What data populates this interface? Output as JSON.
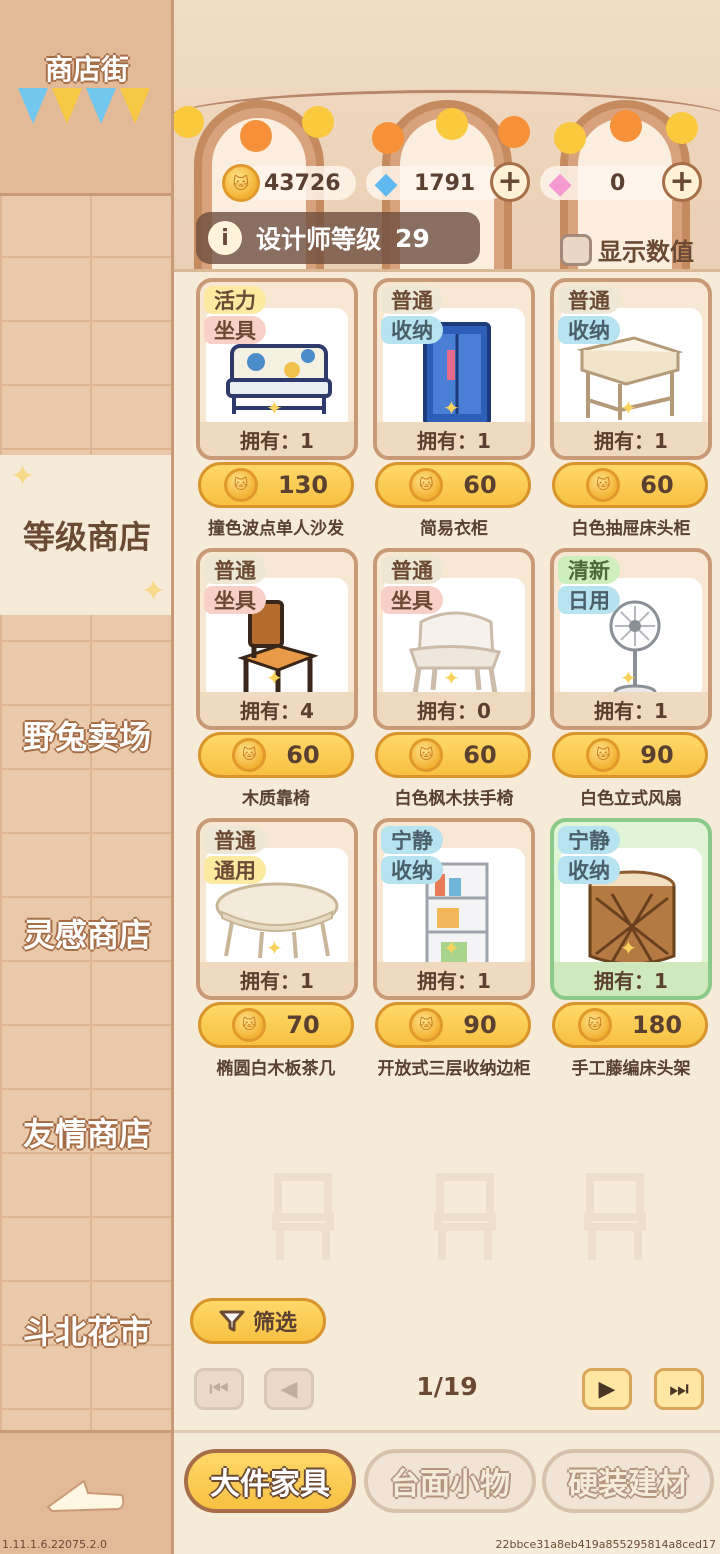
{
  "sidebar": {
    "title": "商店街",
    "items": [
      {
        "label": "等级商店",
        "active": true
      },
      {
        "label": "野兔卖场",
        "active": false
      },
      {
        "label": "灵感商店",
        "active": false
      },
      {
        "label": "友情商店",
        "active": false
      },
      {
        "label": "斗北花市",
        "active": false
      }
    ]
  },
  "header": {
    "coins": "43726",
    "diamonds": "1791",
    "pink_gems": "0",
    "designer_level_label": "设计师等级",
    "designer_level": "29",
    "show_values_label": "显示数值"
  },
  "items": [
    {
      "tags": [
        "活力",
        "坐具"
      ],
      "tag_colors": [
        "yellow",
        "pink"
      ],
      "owned": "拥有：1",
      "price": "130",
      "name": "撞色波点单人沙发",
      "icon": "sofa-icon",
      "highlight": false
    },
    {
      "tags": [
        "普通",
        "收纳"
      ],
      "tag_colors": [
        "grey",
        "blue"
      ],
      "owned": "拥有：1",
      "price": "60",
      "name": "简易衣柜",
      "icon": "wardrobe-icon",
      "highlight": false
    },
    {
      "tags": [
        "普通",
        "收纳"
      ],
      "tag_colors": [
        "grey",
        "blue"
      ],
      "owned": "拥有：1",
      "price": "60",
      "name": "白色抽屉床头柜",
      "icon": "nightstand-icon",
      "highlight": false
    },
    {
      "tags": [
        "普通",
        "坐具"
      ],
      "tag_colors": [
        "grey",
        "pink"
      ],
      "owned": "拥有：4",
      "price": "60",
      "name": "木质靠椅",
      "icon": "wooden-chair-icon",
      "highlight": false
    },
    {
      "tags": [
        "普通",
        "坐具"
      ],
      "tag_colors": [
        "grey",
        "pink"
      ],
      "owned": "拥有：0",
      "price": "60",
      "name": "白色枫木扶手椅",
      "icon": "armchair-icon",
      "highlight": false
    },
    {
      "tags": [
        "清新",
        "日用"
      ],
      "tag_colors": [
        "green",
        "blue"
      ],
      "owned": "拥有：1",
      "price": "90",
      "name": "白色立式风扇",
      "icon": "fan-icon",
      "highlight": false
    },
    {
      "tags": [
        "普通",
        "通用"
      ],
      "tag_colors": [
        "grey",
        "yellow"
      ],
      "owned": "拥有：1",
      "price": "70",
      "name": "椭圆白木板茶几",
      "icon": "coffee-table-icon",
      "highlight": false
    },
    {
      "tags": [
        "宁静",
        "收纳"
      ],
      "tag_colors": [
        "blue",
        "blue"
      ],
      "owned": "拥有：1",
      "price": "90",
      "name": "开放式三层收纳边柜",
      "icon": "shelf-icon",
      "highlight": false
    },
    {
      "tags": [
        "宁静",
        "收纳"
      ],
      "tag_colors": [
        "blue",
        "blue"
      ],
      "owned": "拥有：1",
      "price": "180",
      "name": "手工藤编床头架",
      "icon": "rattan-stand-icon",
      "highlight": true
    }
  ],
  "controls": {
    "filter_label": "筛选",
    "page": "1/19"
  },
  "tabs": [
    {
      "label": "大件家具",
      "active": true
    },
    {
      "label": "台面小物",
      "active": false
    },
    {
      "label": "硬装建材",
      "active": false
    }
  ],
  "footer": {
    "version": "1.11.1.6.22075.2.0",
    "build_hash": "22bbce31a8eb419a855295814a8ced17"
  },
  "colors": {
    "coin": "#f7c142",
    "accent_border": "#c99a78",
    "highlight_border": "#8bc98a"
  }
}
